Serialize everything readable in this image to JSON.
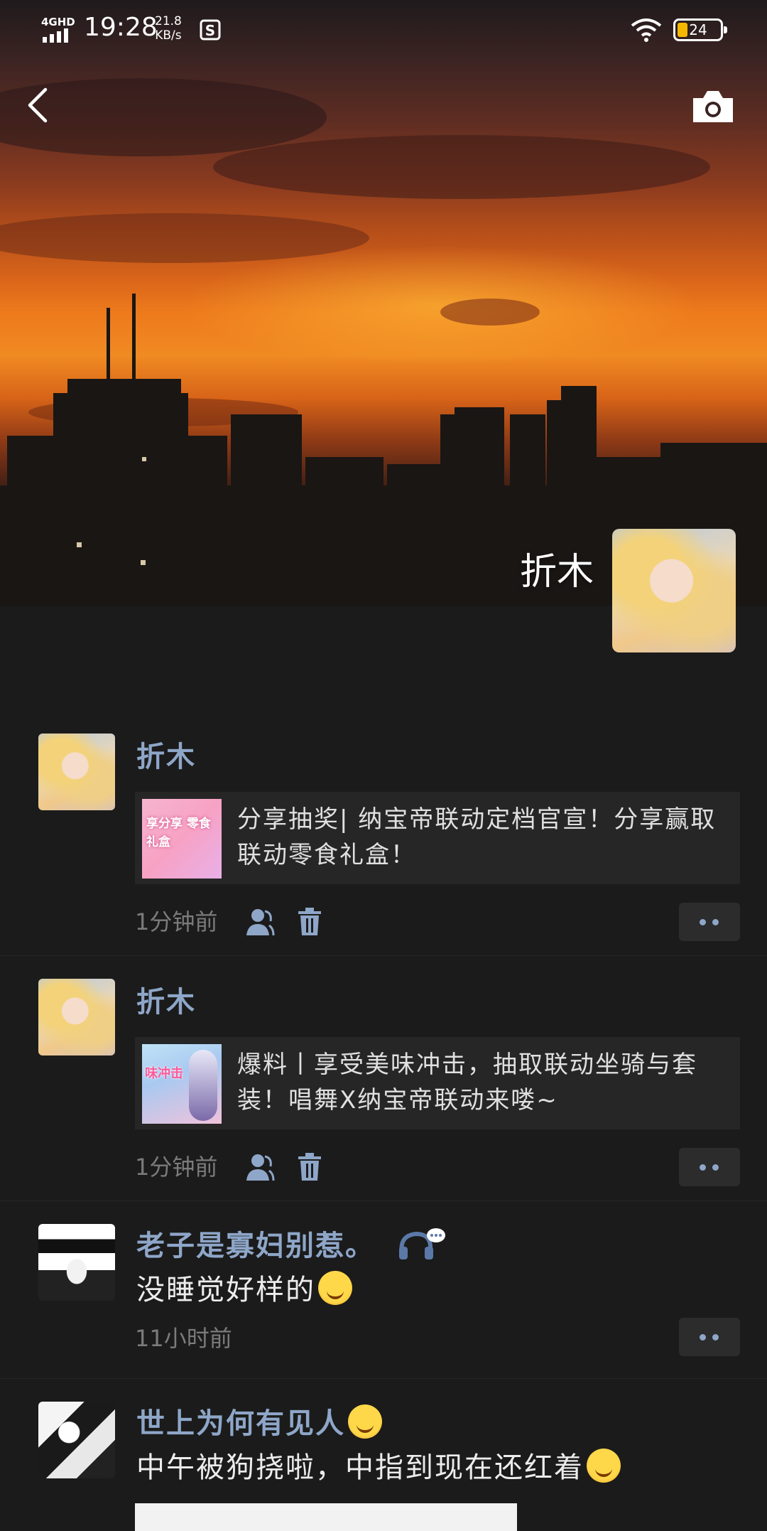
{
  "status_bar": {
    "network": "4GHD",
    "time": "19:28",
    "speed_value": "21.8",
    "speed_unit": "KB/s",
    "battery": "24",
    "battery_level_percent": 24
  },
  "profile": {
    "name": "折木"
  },
  "icons": {
    "back": "back-arrow-icon",
    "camera": "camera-icon",
    "visible_to": "people-icon",
    "delete": "trash-icon",
    "more": "more-dots-icon",
    "music": "music-comment-icon"
  },
  "colors": {
    "background": "#1b1b1b",
    "nickname": "#8ea6c8",
    "meta": "#7b7b7b",
    "card": "#262626"
  },
  "feed": [
    {
      "author": "折木",
      "share_text": "分享抽奖| 纳宝帝联动定档官宣！分享赢取联动零食礼盒！",
      "thumb_text": "享分享 零食礼盒",
      "time": "1分钟前"
    },
    {
      "author": "折木",
      "share_text": "爆料丨享受美味冲击，抽取联动坐骑与套装！唱舞X纳宝帝联动来喽~",
      "thumb_text": "味冲击",
      "time": "1分钟前"
    },
    {
      "author": "老子是寡妇别惹。",
      "text": "没睡觉好样的",
      "time": "11小时前"
    },
    {
      "author": "世上为何有见人",
      "text": "中午被狗挠啦，中指到现在还红着"
    }
  ]
}
